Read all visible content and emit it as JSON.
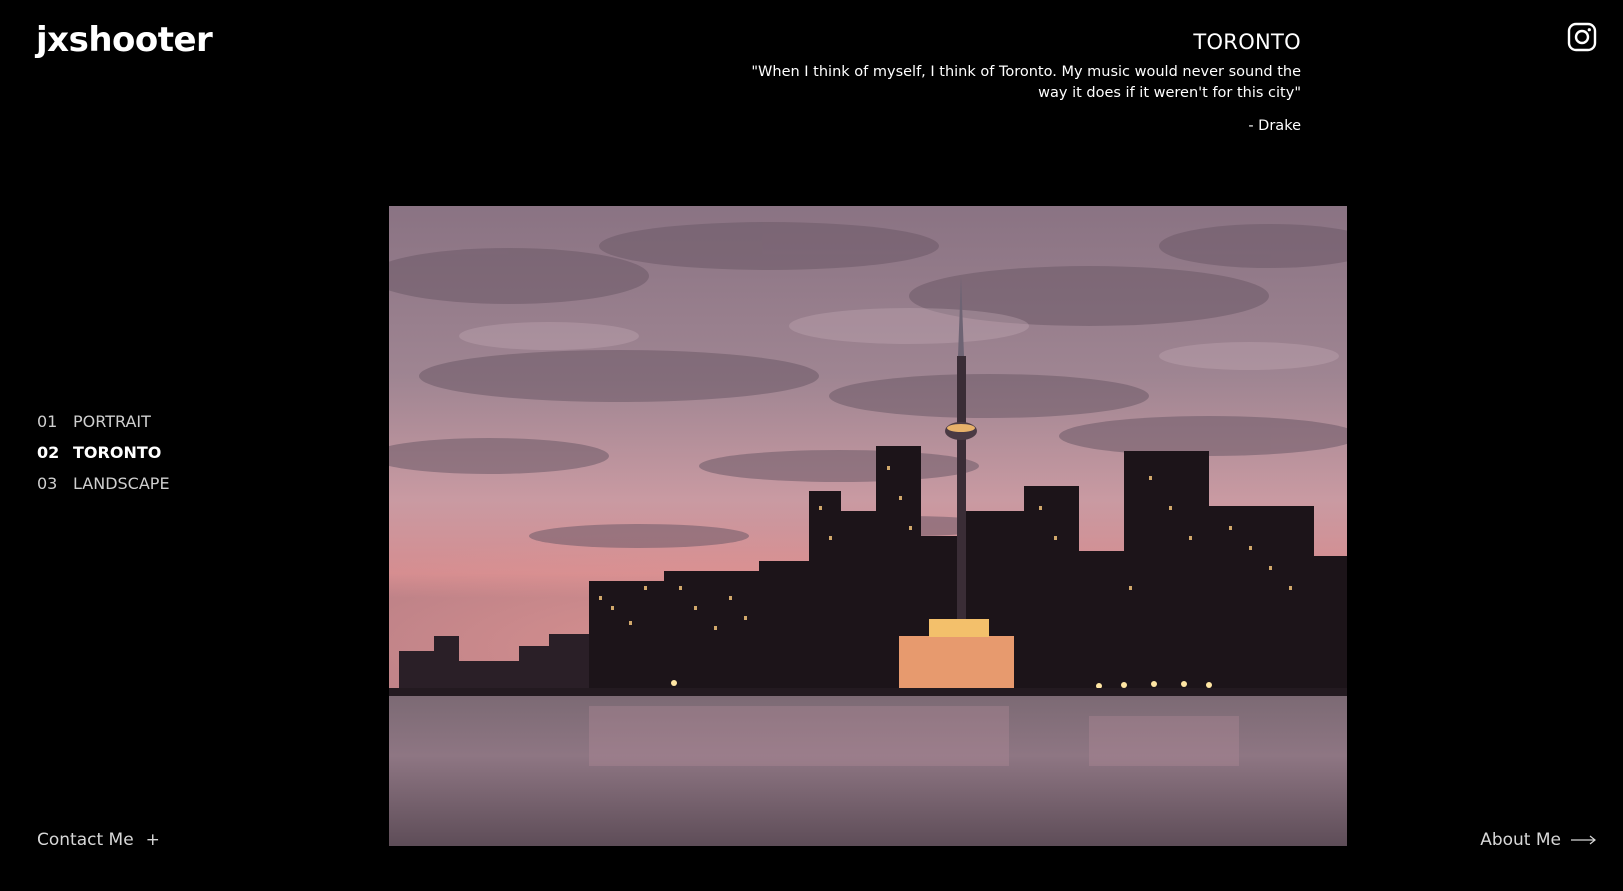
{
  "header": {
    "logo": "jxshooter",
    "instagram_icon": "instagram-icon"
  },
  "gallery": {
    "title": "TORONTO",
    "quote": "\"When I think of myself, I think of Toronto. My music would never sound the way it does if it weren't for this city\"",
    "author": "- Drake"
  },
  "nav": {
    "items": [
      {
        "num": "01",
        "label": "PORTRAIT",
        "active": false
      },
      {
        "num": "02",
        "label": "TORONTO",
        "active": true
      },
      {
        "num": "03",
        "label": "LANDSCAPE",
        "active": false
      }
    ]
  },
  "footer": {
    "contact_label": "Contact Me",
    "contact_icon": "plus-icon",
    "about_label": "About Me",
    "about_icon": "arrow-right-icon"
  },
  "colors": {
    "background": "#000000",
    "text": "#ffffff",
    "muted_text": "#cfcfcf"
  }
}
